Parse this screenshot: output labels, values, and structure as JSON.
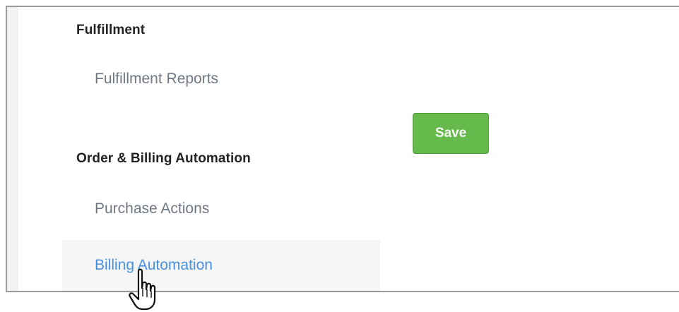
{
  "sections": [
    {
      "heading": "Fulfillment",
      "items": [
        {
          "label": "Fulfillment Reports",
          "active": false
        }
      ]
    },
    {
      "heading": "Order & Billing Automation",
      "items": [
        {
          "label": "Purchase Actions",
          "active": false
        },
        {
          "label": "Billing Automation",
          "active": true
        }
      ]
    }
  ],
  "save_button": {
    "label": "Save"
  },
  "colors": {
    "save_green": "#66b94b",
    "active_link": "#4a90e2",
    "muted_link": "#6f7882"
  },
  "cursor_icon": "hand-pointer-icon"
}
